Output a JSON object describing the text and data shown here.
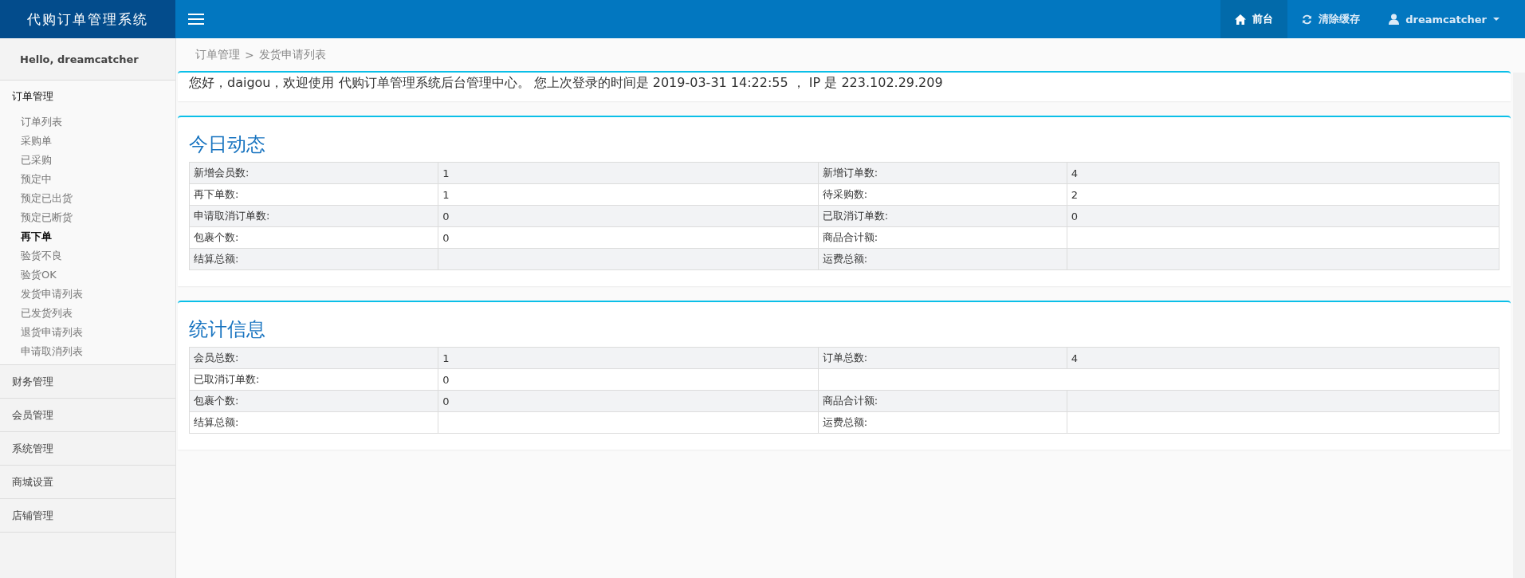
{
  "brand": {
    "title": "代购订单管理系统"
  },
  "header": {
    "nav": [
      {
        "kind": "home",
        "label": "前台",
        "selected": true
      },
      {
        "kind": "refresh",
        "label": "清除缓存",
        "selected": false
      },
      {
        "kind": "user",
        "label": "dreamcatcher",
        "selected": false
      }
    ]
  },
  "sidebar": {
    "greeting": "Hello, dreamcatcher",
    "groups": [
      {
        "label": "订单管理",
        "expanded": true,
        "children": [
          {
            "label": "订单列表",
            "selected": false
          },
          {
            "label": "采购单",
            "selected": false
          },
          {
            "label": "已采购",
            "selected": false
          },
          {
            "label": "预定中",
            "selected": false
          },
          {
            "label": "预定已出货",
            "selected": false
          },
          {
            "label": "预定已断货",
            "selected": false
          },
          {
            "label": "再下单",
            "selected": true
          },
          {
            "label": "验货不良",
            "selected": false
          },
          {
            "label": "验货OK",
            "selected": false
          },
          {
            "label": "发货申请列表",
            "selected": false
          },
          {
            "label": "已发货列表",
            "selected": false
          },
          {
            "label": "退货申请列表",
            "selected": false
          },
          {
            "label": "申请取消列表",
            "selected": false
          }
        ]
      },
      {
        "label": "财务管理",
        "expanded": false
      },
      {
        "label": "会员管理",
        "expanded": false
      },
      {
        "label": "系统管理",
        "expanded": false
      },
      {
        "label": "商城设置",
        "expanded": false
      },
      {
        "label": "店铺管理",
        "expanded": false
      }
    ]
  },
  "breadcrumb": [
    "订单管理",
    ">",
    "发货申请列表"
  ],
  "welcome": "您好，daigou，欢迎使用 代购订单管理系统后台管理中心。 您上次登录的时间是 2019-03-31 14:22:55 ， IP 是 223.102.29.209",
  "panels": [
    {
      "title": "今日动态",
      "rows": [
        {
          "label_1": "新增会员数:",
          "value_1": "1",
          "label_2": "新增订单数:",
          "value_2": "4"
        },
        {
          "label_1": "再下单数:",
          "value_1": "1",
          "label_2": "待采购数:",
          "value_2": "2"
        },
        {
          "label_1": "申请取消订单数:",
          "value_1": "0",
          "label_2": "已取消订单数:",
          "value_2": "0"
        },
        {
          "label_1": "包裹个数:",
          "value_1": "0",
          "label_2": "商品合计额:"
        },
        {
          "label_1": "结算总额:",
          "label_2": "运费总额:"
        }
      ]
    },
    {
      "title": "统计信息",
      "rows": [
        {
          "label_1": "会员总数:",
          "value_1": "1",
          "label_2": "订单总数:",
          "value_2": "4"
        },
        {
          "label_1": "已取消订单数:",
          "value_1": "0"
        },
        {
          "label_1": "包裹个数:",
          "value_1": "0",
          "label_2": "商品合计额:"
        },
        {
          "label_1": "结算总额:",
          "label_2": "运费总额:"
        }
      ]
    }
  ]
}
